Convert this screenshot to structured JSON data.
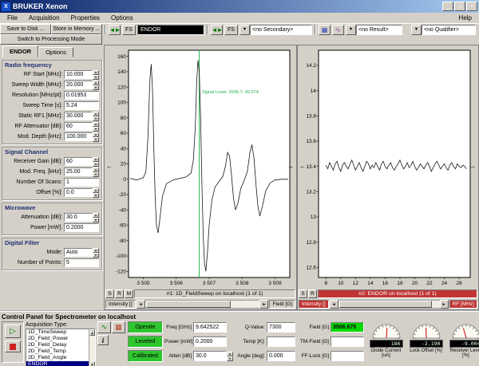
{
  "window": {
    "title": "BRUKER Xenon"
  },
  "icons": {
    "app": "X",
    "minimize": "_",
    "maximize": "□",
    "close": "×",
    "swap": "◄►",
    "dropdown": "▼",
    "left_arrow": "←",
    "right_arrow": "→",
    "scroll_left": "◄",
    "scroll_right": "►",
    "scroll_up": "▲",
    "scroll_down": "▼",
    "play": "▷",
    "info": "i",
    "tune": "∿",
    "fine_tune": "▦",
    "result_tool_1": "▦",
    "result_tool_2": "∿"
  },
  "menu": {
    "items": [
      "File",
      "Acquisition",
      "Properties",
      "Options"
    ],
    "help": "Help"
  },
  "toolbar": {
    "save_to_disk": "Save to Disk ...",
    "store_in_memory": "Store in Memory ...",
    "switch_mode": "Switch to Processing Mode",
    "fs_label": "FS",
    "primary_value": "ENDOR",
    "secondary_value": "<no Secondary>",
    "result_value": "<no Result>",
    "qualifier_value": "<no Qualifier>"
  },
  "left_panel": {
    "tabs": [
      "ENDOR",
      "Options"
    ],
    "active_tab": "ENDOR",
    "sections": [
      {
        "title": "Radio frequency",
        "fields": [
          {
            "label": "RF Start [MHz]:",
            "value": "10.000",
            "spin": true
          },
          {
            "label": "Sweep Width [MHz]:",
            "value": "20.000",
            "spin": true
          },
          {
            "label": "Resolution [MHz/pt]:",
            "value": "0.01953",
            "spin": false
          },
          {
            "label": "Sweep Time [s]:",
            "value": "5.24",
            "spin": false
          },
          {
            "label": "Static RF1 [MHz]:",
            "value": "30.000",
            "spin": true
          },
          {
            "label": "RF Attenuator [dB]:",
            "value": "60",
            "spin": true
          },
          {
            "label": "Mod. Depth [kHz]:",
            "value": "100.000",
            "spin": true
          }
        ]
      },
      {
        "title": "Signal Channel",
        "fields": [
          {
            "label": "Receiver Gain [dB]:",
            "value": "60",
            "spin": true
          },
          {
            "label": "Mod. Freq. [kHz]:",
            "value": "25.00",
            "spin": true
          },
          {
            "label": "Number Of Scans:",
            "value": "1",
            "spin": false
          },
          {
            "label": "Offset [%]:",
            "value": "0.0",
            "spin": true
          }
        ]
      },
      {
        "title": "Microwave",
        "fields": [
          {
            "label": "Attenuation [dB]:",
            "value": "30.0",
            "spin": true
          },
          {
            "label": "Power [mW]:",
            "value": "0.2000",
            "spin": false
          }
        ]
      },
      {
        "title": "Digital Filter",
        "fields": [
          {
            "label": "Mode:",
            "value": "Auto",
            "spin": true
          },
          {
            "label": "Number of Points:",
            "value": "5",
            "spin": false
          }
        ]
      }
    ]
  },
  "viewers": [
    {
      "buttons": [
        "S",
        "R",
        "M"
      ]
    },
    {
      "buttons": [
        "S",
        "R"
      ]
    }
  ],
  "chart_data": [
    {
      "type": "line",
      "title": "#1: 1D_FieldSweep on localhost (1 of 1)",
      "xlabel": "Field [G]",
      "ylabel": "Intensity []",
      "xlim": [
        3504.55,
        3509.45
      ],
      "ylim": [
        -128,
        168
      ],
      "x_ticks": [
        3505,
        3506,
        3507,
        3508,
        3509
      ],
      "x_tick_labels": [
        "3 505",
        "3 506",
        "3 507",
        "3 508",
        "3 509"
      ],
      "y_ticks": [
        160,
        140,
        120,
        100,
        80,
        60,
        40,
        20,
        0,
        -20,
        -40,
        -60,
        -80,
        -100,
        -120
      ],
      "cursor_x": 3506.7,
      "annotation": {
        "text": "Signal Level: 3506.7: 99.974",
        "x": 3506.78,
        "y": 112
      },
      "grid": false,
      "series": [
        {
          "name": "1D_FieldSweep",
          "x": [
            3504.6,
            3504.8,
            3505.0,
            3505.08,
            3505.14,
            3505.2,
            3505.24,
            3505.28,
            3505.32,
            3505.36,
            3505.4,
            3505.45,
            3505.5,
            3505.58,
            3505.7,
            3505.9,
            3506.1,
            3506.3,
            3506.45,
            3506.52,
            3506.58,
            3506.62,
            3506.66,
            3506.7,
            3506.74,
            3506.78,
            3506.82,
            3506.86,
            3506.9,
            3506.95,
            3507.0,
            3507.08,
            3507.18,
            3507.3,
            3507.42,
            3507.5,
            3507.56,
            3507.62,
            3507.68,
            3507.74,
            3507.8,
            3507.88,
            3507.96,
            3508.06,
            3508.16,
            3508.24,
            3508.3,
            3508.36,
            3508.42,
            3508.48,
            3508.54,
            3508.62,
            3508.72,
            3508.85,
            3509.0,
            3509.2,
            3509.4
          ],
          "y": [
            1,
            -1,
            2,
            10,
            55,
            130,
            150,
            115,
            40,
            -25,
            -60,
            -70,
            -52,
            -22,
            -6,
            -1,
            1,
            3,
            8,
            25,
            70,
            125,
            155,
            140,
            80,
            -5,
            -75,
            -110,
            -120,
            -95,
            -60,
            -28,
            -10,
            -3,
            4,
            18,
            35,
            30,
            5,
            -25,
            -40,
            -30,
            -12,
            -2,
            10,
            35,
            45,
            28,
            -5,
            -35,
            -48,
            -35,
            -15,
            -5,
            -1,
            0,
            0
          ]
        }
      ]
    },
    {
      "type": "line",
      "title": "#2: ENDOR on localhost (1 of 1)",
      "xlabel": "RF [MHz]",
      "ylabel": "Intensity []",
      "xlim": [
        7,
        27.5
      ],
      "ylim": [
        12.52,
        14.32
      ],
      "x_ticks": [
        8,
        10,
        12,
        14,
        16,
        18,
        20,
        22,
        24,
        26
      ],
      "x_tick_labels": [
        "8",
        "10",
        "12",
        "14",
        "16",
        "18",
        "20",
        "22",
        "24",
        "26"
      ],
      "y_ticks": [
        14.2,
        14.0,
        13.8,
        13.6,
        13.4,
        13.2,
        13.0,
        12.8,
        12.6
      ],
      "y_tick_labels": [
        "14.2",
        "14",
        "13.8",
        "13.6",
        "13.4",
        "13.2",
        "13",
        "12.8",
        "12.6"
      ],
      "grid": false,
      "series": [
        {
          "name": "ENDOR",
          "x_start": 8.0,
          "x_step": 0.25,
          "y": [
            13.41,
            13.38,
            13.43,
            13.4,
            13.37,
            13.42,
            13.44,
            13.39,
            13.36,
            13.41,
            13.43,
            13.4,
            13.38,
            13.42,
            13.45,
            13.41,
            13.37,
            13.4,
            13.43,
            13.39,
            13.36,
            13.4,
            13.44,
            13.42,
            13.38,
            13.41,
            13.39,
            13.43,
            13.4,
            13.37,
            13.42,
            13.44,
            13.4,
            13.38,
            13.41,
            13.43,
            13.39,
            13.37,
            13.4,
            13.42,
            13.45,
            13.41,
            13.38,
            13.4,
            13.43,
            13.39,
            13.41,
            13.44,
            13.4,
            13.37,
            13.39,
            13.42,
            13.4,
            13.38,
            13.41,
            13.43,
            13.4,
            13.36,
            13.39,
            13.42,
            13.44,
            13.41,
            13.38,
            13.4,
            13.42,
            13.39,
            13.37,
            13.41,
            13.43,
            13.4,
            13.38,
            13.42,
            13.4,
            13.39,
            13.41,
            13.4,
            13.38
          ]
        }
      ]
    }
  ],
  "control_panel": {
    "title": "Control Panel for Spectrometer on localhost",
    "acquisition": {
      "label": "Acquisition Type:",
      "items": [
        "1D_TimeSweep",
        "2D_Field_Power",
        "2D_Field_Delay",
        "2D_Field_Temp",
        "2D_Field_Angle",
        "ENDOR"
      ],
      "selected": "ENDOR"
    },
    "status": [
      "Operate",
      "Leveled",
      "Calibrated"
    ],
    "field_columns": [
      [
        {
          "label": "Freq [GHz]",
          "value": "9.642522"
        },
        {
          "label": "Power [mW]",
          "value": "0.2000"
        },
        {
          "label": "Atten [dB]",
          "value": "30.0",
          "spin": true
        }
      ],
      [
        {
          "label": "Q-Value:",
          "value": "7300"
        },
        {
          "label": "Temp [K]:",
          "value": ""
        },
        {
          "label": "Angle [deg]:",
          "value": "0.000"
        }
      ],
      [
        {
          "label": "Field [G]",
          "value": "3506.675",
          "highlight": true
        },
        {
          "label": "TM-Field [G]",
          "value": ""
        },
        {
          "label": "FF-Lock [G]",
          "value": ""
        }
      ]
    ],
    "gauges": [
      {
        "label": "Diode Current [uA]",
        "value": "186",
        "needle_frac": 0.52
      },
      {
        "label": "Lock Offset [%]",
        "value": "-2.190",
        "needle_frac": 0.49
      },
      {
        "label": "Receiver Level [%]",
        "value": "-9.004",
        "needle_frac": 0.41
      }
    ]
  },
  "colors": {
    "titlebar_left": "#0a246a",
    "titlebar_right": "#a6caf0",
    "cursor_green": "#22b14c",
    "viewer2_red": "#c13434",
    "status_green": "#2ec52e",
    "field_green": "#00d800",
    "selection_blue": "#000080",
    "window_gray": "#d4d0c8"
  }
}
